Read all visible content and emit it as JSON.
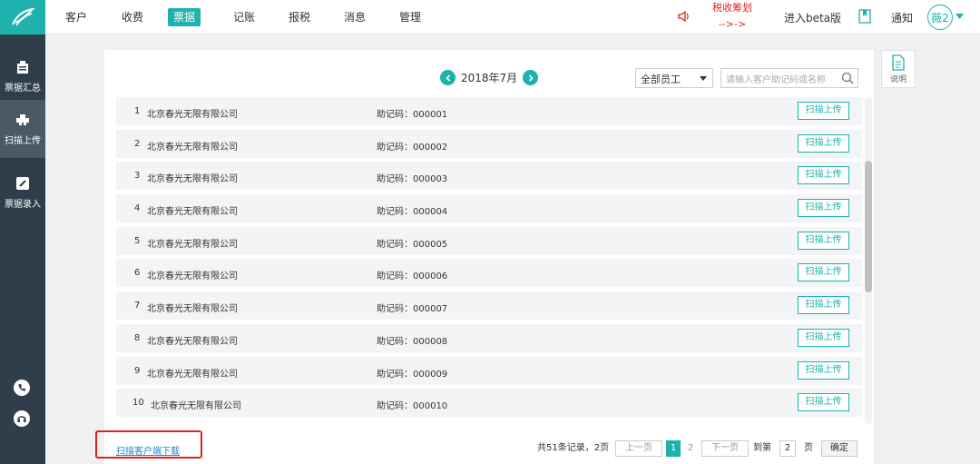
{
  "sidebar": {
    "items": [
      {
        "label": "票据汇总",
        "icon": "building-icon"
      },
      {
        "label": "扫描上传",
        "icon": "scanner-icon"
      },
      {
        "label": "票据录入",
        "icon": "edit-icon"
      }
    ],
    "bottom_icons": [
      "phone-icon",
      "headset-icon"
    ]
  },
  "nav": {
    "items": [
      "客户",
      "收费",
      "票据",
      "记账",
      "报税",
      "消息",
      "管理"
    ],
    "active": "票据",
    "tax_alert_line1": "税收筹划",
    "tax_alert_line2": "-->->",
    "beta": "进入beta版",
    "notify": "通知",
    "avatar": "薇2"
  },
  "toolbar": {
    "month": "2018年7月",
    "employee_select": "全部员工",
    "search_placeholder": "请输入客户助记码或名称"
  },
  "rows": [
    {
      "idx": "1",
      "name": "北京春光无限有限公司",
      "code": "助记码：000001",
      "btn": "扫描上传"
    },
    {
      "idx": "2",
      "name": "北京春光无限有限公司",
      "code": "助记码：000002",
      "btn": "扫描上传"
    },
    {
      "idx": "3",
      "name": "北京春光无限有限公司",
      "code": "助记码：000003",
      "btn": "扫描上传"
    },
    {
      "idx": "4",
      "name": "北京春光无限有限公司",
      "code": "助记码：000004",
      "btn": "扫描上传"
    },
    {
      "idx": "5",
      "name": "北京春光无限有限公司",
      "code": "助记码：000005",
      "btn": "扫描上传"
    },
    {
      "idx": "6",
      "name": "北京春光无限有限公司",
      "code": "助记码：000006",
      "btn": "扫描上传"
    },
    {
      "idx": "7",
      "name": "北京春光无限有限公司",
      "code": "助记码：000007",
      "btn": "扫描上传"
    },
    {
      "idx": "8",
      "name": "北京春光无限有限公司",
      "code": "助记码：000008",
      "btn": "扫描上传"
    },
    {
      "idx": "9",
      "name": "北京春光无限有限公司",
      "code": "助记码：000009",
      "btn": "扫描上传"
    },
    {
      "idx": "10",
      "name": "北京春光无限有限公司",
      "code": "助记码：000010",
      "btn": "扫描上传"
    }
  ],
  "footer": {
    "download_link": "扫描客户端下载",
    "total": "共51条记录，2页",
    "prev": "上一页",
    "page1": "1",
    "page2": "2",
    "next": "下一页",
    "goto_label": "到第",
    "goto_value": "2",
    "page_unit": "页",
    "confirm": "确定"
  },
  "help": {
    "label": "说明"
  },
  "colors": {
    "accent": "#1eb1ae",
    "sidebar": "#2f3e4a",
    "alert": "#e02020",
    "link": "#2a86d0"
  }
}
